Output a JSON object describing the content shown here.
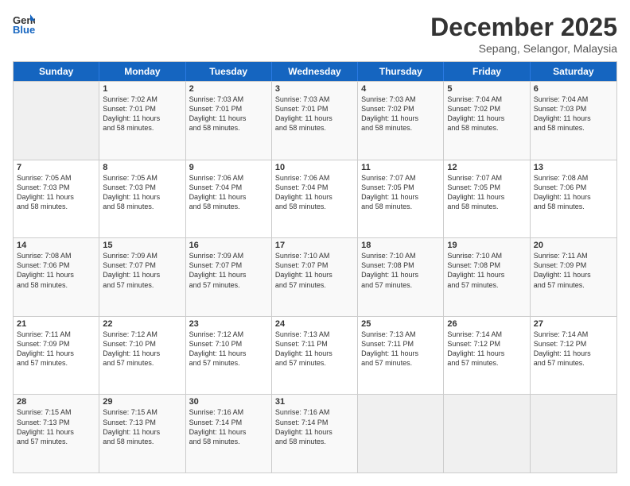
{
  "logo": {
    "line1": "General",
    "line2": "Blue"
  },
  "title": "December 2025",
  "subtitle": "Sepang, Selangor, Malaysia",
  "days": [
    "Sunday",
    "Monday",
    "Tuesday",
    "Wednesday",
    "Thursday",
    "Friday",
    "Saturday"
  ],
  "weeks": [
    [
      {
        "day": "",
        "lines": []
      },
      {
        "day": "1",
        "lines": [
          "Sunrise: 7:02 AM",
          "Sunset: 7:01 PM",
          "Daylight: 11 hours",
          "and 58 minutes."
        ]
      },
      {
        "day": "2",
        "lines": [
          "Sunrise: 7:03 AM",
          "Sunset: 7:01 PM",
          "Daylight: 11 hours",
          "and 58 minutes."
        ]
      },
      {
        "day": "3",
        "lines": [
          "Sunrise: 7:03 AM",
          "Sunset: 7:01 PM",
          "Daylight: 11 hours",
          "and 58 minutes."
        ]
      },
      {
        "day": "4",
        "lines": [
          "Sunrise: 7:03 AM",
          "Sunset: 7:02 PM",
          "Daylight: 11 hours",
          "and 58 minutes."
        ]
      },
      {
        "day": "5",
        "lines": [
          "Sunrise: 7:04 AM",
          "Sunset: 7:02 PM",
          "Daylight: 11 hours",
          "and 58 minutes."
        ]
      },
      {
        "day": "6",
        "lines": [
          "Sunrise: 7:04 AM",
          "Sunset: 7:03 PM",
          "Daylight: 11 hours",
          "and 58 minutes."
        ]
      }
    ],
    [
      {
        "day": "7",
        "lines": [
          "Sunrise: 7:05 AM",
          "Sunset: 7:03 PM",
          "Daylight: 11 hours",
          "and 58 minutes."
        ]
      },
      {
        "day": "8",
        "lines": [
          "Sunrise: 7:05 AM",
          "Sunset: 7:03 PM",
          "Daylight: 11 hours",
          "and 58 minutes."
        ]
      },
      {
        "day": "9",
        "lines": [
          "Sunrise: 7:06 AM",
          "Sunset: 7:04 PM",
          "Daylight: 11 hours",
          "and 58 minutes."
        ]
      },
      {
        "day": "10",
        "lines": [
          "Sunrise: 7:06 AM",
          "Sunset: 7:04 PM",
          "Daylight: 11 hours",
          "and 58 minutes."
        ]
      },
      {
        "day": "11",
        "lines": [
          "Sunrise: 7:07 AM",
          "Sunset: 7:05 PM",
          "Daylight: 11 hours",
          "and 58 minutes."
        ]
      },
      {
        "day": "12",
        "lines": [
          "Sunrise: 7:07 AM",
          "Sunset: 7:05 PM",
          "Daylight: 11 hours",
          "and 58 minutes."
        ]
      },
      {
        "day": "13",
        "lines": [
          "Sunrise: 7:08 AM",
          "Sunset: 7:06 PM",
          "Daylight: 11 hours",
          "and 58 minutes."
        ]
      }
    ],
    [
      {
        "day": "14",
        "lines": [
          "Sunrise: 7:08 AM",
          "Sunset: 7:06 PM",
          "Daylight: 11 hours",
          "and 58 minutes."
        ]
      },
      {
        "day": "15",
        "lines": [
          "Sunrise: 7:09 AM",
          "Sunset: 7:07 PM",
          "Daylight: 11 hours",
          "and 57 minutes."
        ]
      },
      {
        "day": "16",
        "lines": [
          "Sunrise: 7:09 AM",
          "Sunset: 7:07 PM",
          "Daylight: 11 hours",
          "and 57 minutes."
        ]
      },
      {
        "day": "17",
        "lines": [
          "Sunrise: 7:10 AM",
          "Sunset: 7:07 PM",
          "Daylight: 11 hours",
          "and 57 minutes."
        ]
      },
      {
        "day": "18",
        "lines": [
          "Sunrise: 7:10 AM",
          "Sunset: 7:08 PM",
          "Daylight: 11 hours",
          "and 57 minutes."
        ]
      },
      {
        "day": "19",
        "lines": [
          "Sunrise: 7:10 AM",
          "Sunset: 7:08 PM",
          "Daylight: 11 hours",
          "and 57 minutes."
        ]
      },
      {
        "day": "20",
        "lines": [
          "Sunrise: 7:11 AM",
          "Sunset: 7:09 PM",
          "Daylight: 11 hours",
          "and 57 minutes."
        ]
      }
    ],
    [
      {
        "day": "21",
        "lines": [
          "Sunrise: 7:11 AM",
          "Sunset: 7:09 PM",
          "Daylight: 11 hours",
          "and 57 minutes."
        ]
      },
      {
        "day": "22",
        "lines": [
          "Sunrise: 7:12 AM",
          "Sunset: 7:10 PM",
          "Daylight: 11 hours",
          "and 57 minutes."
        ]
      },
      {
        "day": "23",
        "lines": [
          "Sunrise: 7:12 AM",
          "Sunset: 7:10 PM",
          "Daylight: 11 hours",
          "and 57 minutes."
        ]
      },
      {
        "day": "24",
        "lines": [
          "Sunrise: 7:13 AM",
          "Sunset: 7:11 PM",
          "Daylight: 11 hours",
          "and 57 minutes."
        ]
      },
      {
        "day": "25",
        "lines": [
          "Sunrise: 7:13 AM",
          "Sunset: 7:11 PM",
          "Daylight: 11 hours",
          "and 57 minutes."
        ]
      },
      {
        "day": "26",
        "lines": [
          "Sunrise: 7:14 AM",
          "Sunset: 7:12 PM",
          "Daylight: 11 hours",
          "and 57 minutes."
        ]
      },
      {
        "day": "27",
        "lines": [
          "Sunrise: 7:14 AM",
          "Sunset: 7:12 PM",
          "Daylight: 11 hours",
          "and 57 minutes."
        ]
      }
    ],
    [
      {
        "day": "28",
        "lines": [
          "Sunrise: 7:15 AM",
          "Sunset: 7:13 PM",
          "Daylight: 11 hours",
          "and 57 minutes."
        ]
      },
      {
        "day": "29",
        "lines": [
          "Sunrise: 7:15 AM",
          "Sunset: 7:13 PM",
          "Daylight: 11 hours",
          "and 58 minutes."
        ]
      },
      {
        "day": "30",
        "lines": [
          "Sunrise: 7:16 AM",
          "Sunset: 7:14 PM",
          "Daylight: 11 hours",
          "and 58 minutes."
        ]
      },
      {
        "day": "31",
        "lines": [
          "Sunrise: 7:16 AM",
          "Sunset: 7:14 PM",
          "Daylight: 11 hours",
          "and 58 minutes."
        ]
      },
      {
        "day": "",
        "lines": []
      },
      {
        "day": "",
        "lines": []
      },
      {
        "day": "",
        "lines": []
      }
    ]
  ]
}
